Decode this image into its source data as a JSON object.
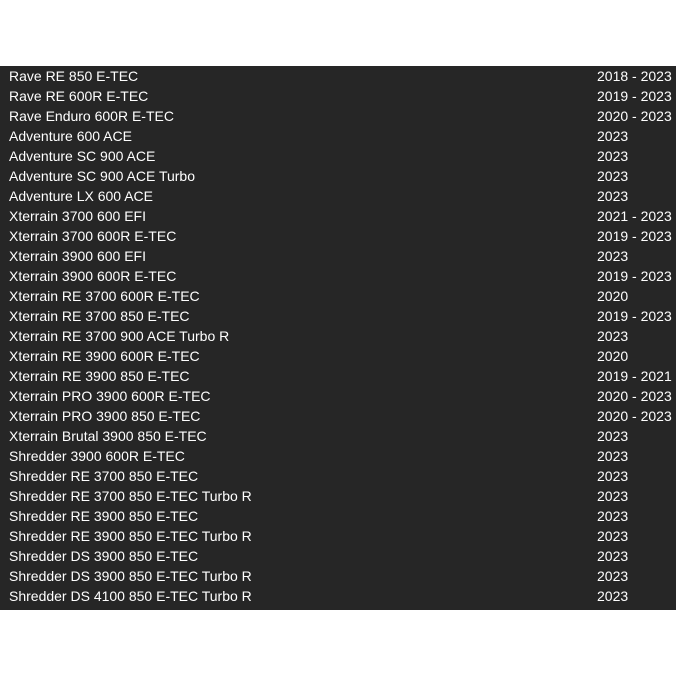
{
  "table": {
    "rows": [
      {
        "model": "Rave RE 850 E-TEC",
        "years": "2018 - 2023"
      },
      {
        "model": "Rave RE 600R E-TEC",
        "years": "2019 - 2023"
      },
      {
        "model": "Rave Enduro 600R E-TEC",
        "years": "2020 - 2023"
      },
      {
        "model": "Adventure 600 ACE",
        "years": "2023"
      },
      {
        "model": "Adventure SC 900 ACE",
        "years": "2023"
      },
      {
        "model": "Adventure SC 900 ACE Turbo",
        "years": "2023"
      },
      {
        "model": "Adventure LX 600 ACE",
        "years": "2023"
      },
      {
        "model": "Xterrain 3700 600 EFI",
        "years": "2021 - 2023"
      },
      {
        "model": "Xterrain 3700 600R E-TEC",
        "years": "2019 - 2023"
      },
      {
        "model": "Xterrain 3900 600 EFI",
        "years": "2023"
      },
      {
        "model": "Xterrain 3900 600R E-TEC",
        "years": "2019 - 2023"
      },
      {
        "model": "Xterrain RE 3700 600R E-TEC",
        "years": "2020"
      },
      {
        "model": "Xterrain RE 3700 850 E-TEC",
        "years": "2019 - 2023"
      },
      {
        "model": "Xterrain RE 3700 900 ACE Turbo R",
        "years": "2023"
      },
      {
        "model": "Xterrain RE 3900 600R E-TEC",
        "years": "2020"
      },
      {
        "model": "Xterrain RE 3900 850 E-TEC",
        "years": "2019 - 2021"
      },
      {
        "model": "Xterrain PRO 3900 600R E-TEC",
        "years": "2020 - 2023"
      },
      {
        "model": "Xterrain PRO 3900 850 E-TEC",
        "years": "2020 - 2023"
      },
      {
        "model": "Xterrain Brutal 3900 850 E-TEC",
        "years": "2023"
      },
      {
        "model": "Shredder 3900 600R E-TEC",
        "years": "2023"
      },
      {
        "model": "Shredder RE 3700 850 E-TEC",
        "years": "2023"
      },
      {
        "model": "Shredder RE 3700 850 E-TEC Turbo R",
        "years": "2023"
      },
      {
        "model": "Shredder RE 3900 850 E-TEC",
        "years": "2023"
      },
      {
        "model": "Shredder RE 3900 850 E-TEC Turbo R",
        "years": "2023"
      },
      {
        "model": "Shredder DS 3900 850 E-TEC",
        "years": "2023"
      },
      {
        "model": "Shredder DS 3900 850 E-TEC Turbo R",
        "years": "2023"
      },
      {
        "model": "Shredder DS 4100 850 E-TEC Turbo R",
        "years": "2023"
      }
    ]
  }
}
